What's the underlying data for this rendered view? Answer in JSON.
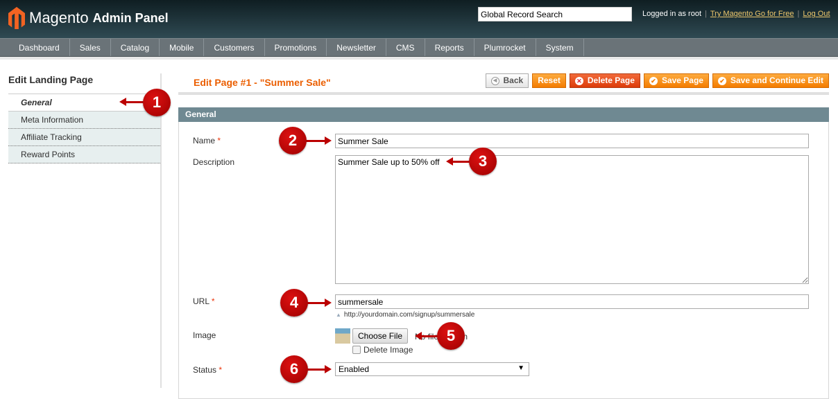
{
  "header": {
    "brand": "Magento",
    "brand_sub": "Admin Panel",
    "search_value": "Global Record Search",
    "logged_in": "Logged in as root",
    "try_link": "Try Magento Go for Free",
    "logout": "Log Out"
  },
  "nav": [
    "Dashboard",
    "Sales",
    "Catalog",
    "Mobile",
    "Customers",
    "Promotions",
    "Newsletter",
    "CMS",
    "Reports",
    "Plumrocket",
    "System"
  ],
  "sidebar": {
    "title": "Edit Landing Page",
    "tabs": [
      "General",
      "Meta Information",
      "Affiliate Tracking",
      "Reward Points"
    ],
    "active": "General"
  },
  "page": {
    "title": "Edit Page #1 - \"Summer Sale\"",
    "buttons": {
      "back": "Back",
      "reset": "Reset",
      "delete": "Delete Page",
      "save": "Save Page",
      "save_continue": "Save and Continue Edit"
    }
  },
  "section": {
    "title": "General",
    "fields": {
      "name_label": "Name",
      "name_value": "Summer Sale",
      "description_label": "Description",
      "description_value": "Summer Sale up to 50% off",
      "url_label": "URL",
      "url_value": "summersale",
      "url_hint": "http://yourdomain.com/signup/summersale",
      "image_label": "Image",
      "choose_file": "Choose File",
      "no_file": "No file chosen",
      "delete_image": "Delete Image",
      "status_label": "Status",
      "status_value": "Enabled",
      "required_mark": "*"
    }
  },
  "callouts": [
    "1",
    "2",
    "3",
    "4",
    "5",
    "6"
  ],
  "colors": {
    "accent": "#eb5e00",
    "button": "#f47c00",
    "callout": "#b00000",
    "section_header": "#6f8992"
  }
}
